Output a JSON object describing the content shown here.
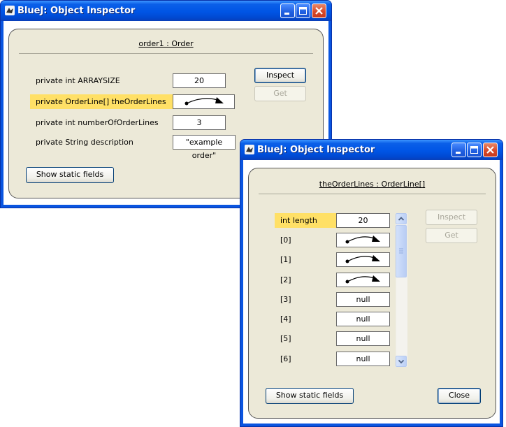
{
  "window1": {
    "title": "BlueJ:  Object Inspector",
    "heading": "order1 : Order",
    "fields": [
      {
        "label": "private int ARRAYSIZE",
        "value": "20",
        "highlighted": false,
        "is_reference": false
      },
      {
        "label": "private OrderLine[] theOrderLines",
        "value": "",
        "highlighted": true,
        "is_reference": true
      },
      {
        "label": "private int numberOfOrderLines",
        "value": "3",
        "highlighted": false,
        "is_reference": false
      },
      {
        "label": "private String description",
        "value": "\"example order\"",
        "highlighted": false,
        "is_reference": false
      }
    ],
    "inspect_label": "Inspect",
    "get_label": "Get",
    "static_label": "Show static fields"
  },
  "window2": {
    "title": "BlueJ:  Object Inspector",
    "heading": "theOrderLines : OrderLine[]",
    "fields": [
      {
        "label": "int length",
        "value": "20",
        "highlighted": true,
        "is_reference": false
      },
      {
        "label": "[0]",
        "value": "",
        "highlighted": false,
        "is_reference": true
      },
      {
        "label": "[1]",
        "value": "",
        "highlighted": false,
        "is_reference": true
      },
      {
        "label": "[2]",
        "value": "",
        "highlighted": false,
        "is_reference": true
      },
      {
        "label": "[3]",
        "value": "null",
        "highlighted": false,
        "is_reference": false
      },
      {
        "label": "[4]",
        "value": "null",
        "highlighted": false,
        "is_reference": false
      },
      {
        "label": "[5]",
        "value": "null",
        "highlighted": false,
        "is_reference": false
      },
      {
        "label": "[6]",
        "value": "null",
        "highlighted": false,
        "is_reference": false
      }
    ],
    "inspect_label": "Inspect",
    "get_label": "Get",
    "static_label": "Show static fields",
    "close_label": "Close"
  },
  "colors": {
    "title_bar": "#0055e5",
    "panel": "#ece9d8",
    "highlight": "#ffe066",
    "close_button": "#d8492a"
  },
  "icons": {
    "app": "bluej-bird-icon",
    "minimize": "minimize-icon",
    "maximize": "maximize-icon",
    "close": "close-icon",
    "reference": "object-reference-arrow-icon"
  }
}
